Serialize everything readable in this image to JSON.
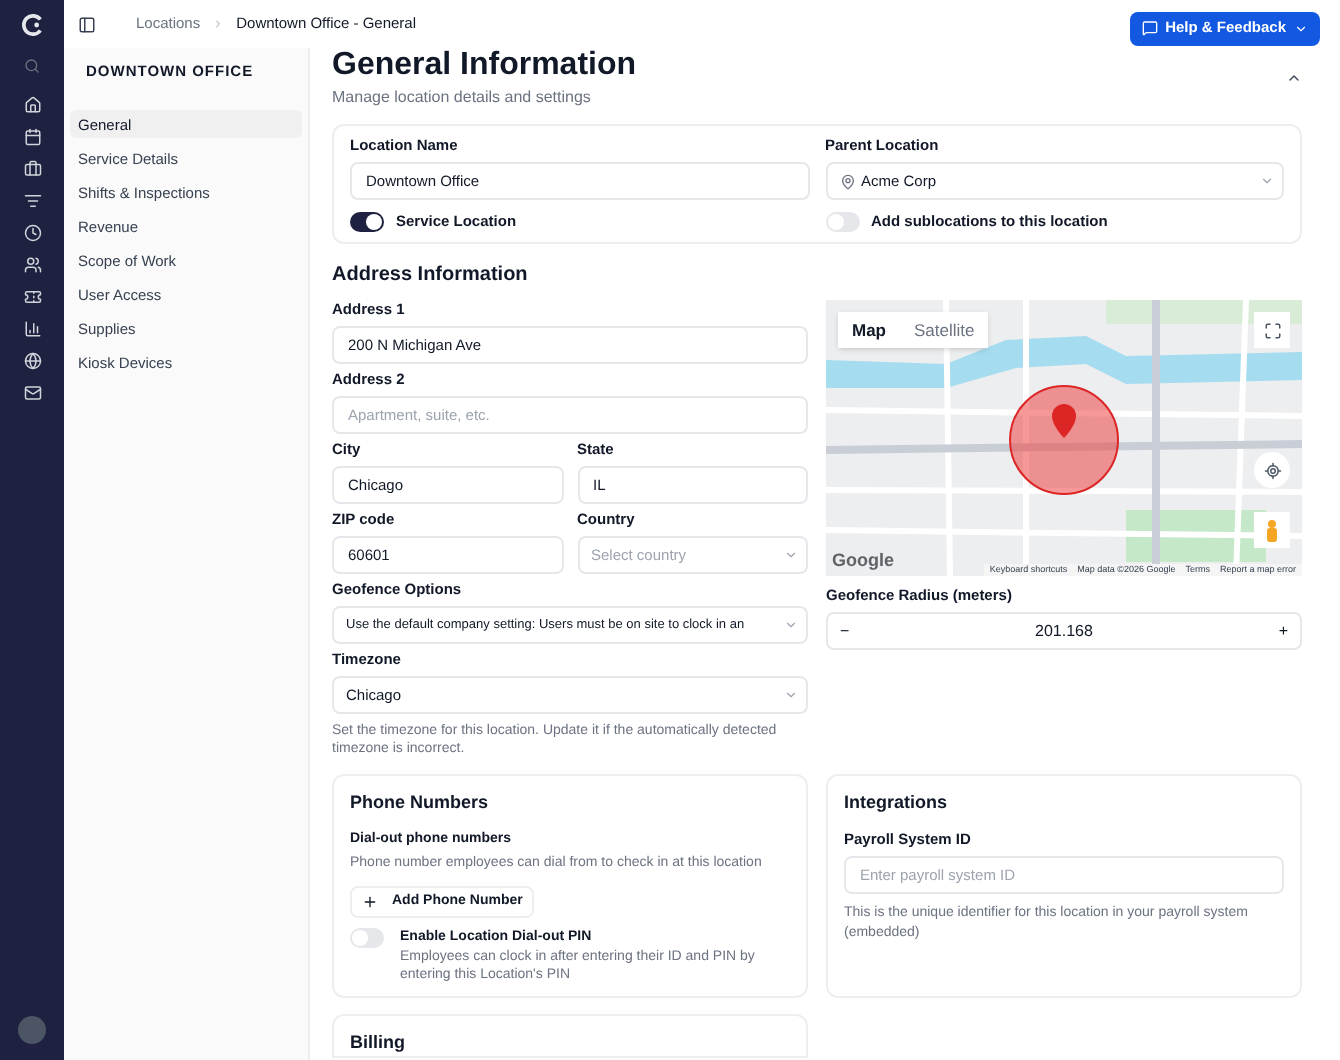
{
  "breadcrumb": [
    {
      "label": "Locations"
    },
    {
      "label": "Downtown Office - General"
    }
  ],
  "help_button": {
    "label": "Help & Feedback"
  },
  "sidebar": {
    "title": "DOWNTOWN OFFICE",
    "items": [
      {
        "label": "General",
        "selected": true
      },
      {
        "label": "Service Details",
        "selected": false
      },
      {
        "label": "Shifts & Inspections",
        "selected": false
      },
      {
        "label": "Revenue",
        "selected": false
      },
      {
        "label": "Scope of Work",
        "selected": false
      },
      {
        "label": "User Access",
        "selected": false
      },
      {
        "label": "Supplies",
        "selected": false
      },
      {
        "label": "Kiosk Devices",
        "selected": false
      }
    ]
  },
  "header": {
    "title": "General Information",
    "subtitle": "Manage location details and settings"
  },
  "location_card": {
    "name_label": "Location Name",
    "name_value": "Downtown Office",
    "service_toggle": {
      "label": "Service Location",
      "on": true
    },
    "parent_label": "Parent Location",
    "parent_value": "Acme Corp",
    "sublocations_toggle": {
      "label": "Add sublocations to this location",
      "on": false
    }
  },
  "address": {
    "title": "Address Information",
    "address1": {
      "label": "Address 1",
      "value": "200 N Michigan Ave"
    },
    "address2": {
      "label": "Address 2",
      "placeholder": "Apartment, suite, etc."
    },
    "city": {
      "label": "City",
      "value": "Chicago"
    },
    "state": {
      "label": "State",
      "value": "IL"
    },
    "zip": {
      "label": "ZIP code",
      "value": "60601"
    },
    "country": {
      "label": "Country",
      "placeholder": "Select country"
    },
    "geofence_options": {
      "label": "Geofence Options",
      "value": "Use the default company setting: Users must be on site to clock in an"
    },
    "timezone": {
      "label": "Timezone",
      "value": "Chicago",
      "help": "Set the timezone for this location. Update it if the automatically detected timezone is incorrect."
    }
  },
  "map": {
    "view_tabs": [
      {
        "label": "Map",
        "selected": true
      },
      {
        "label": "Satellite",
        "selected": false
      }
    ],
    "logo": "Google",
    "footer": [
      "Keyboard shortcuts",
      "Map data ©2026 Google",
      "Terms",
      "Report a map error"
    ]
  },
  "geofence_radius": {
    "label": "Geofence Radius (meters)",
    "minus": "−",
    "value": "201.168",
    "plus": "+"
  },
  "phone_card": {
    "title": "Phone Numbers",
    "subtitle": "Dial-out phone numbers",
    "description": "Phone number employees can dial from to check in at this location",
    "add_button": "Add Phone Number",
    "pin_toggle": {
      "label": "Enable Location Dial-out PIN",
      "description": "Employees can clock in after entering their ID and PIN by entering this Location's PIN",
      "on": false
    }
  },
  "integrations_card": {
    "title": "Integrations",
    "field_label": "Payroll System ID",
    "placeholder": "Enter payroll system ID",
    "help": "This is the unique identifier for this location in your payroll system (embedded)"
  },
  "billing_card": {
    "title": "Billing"
  }
}
